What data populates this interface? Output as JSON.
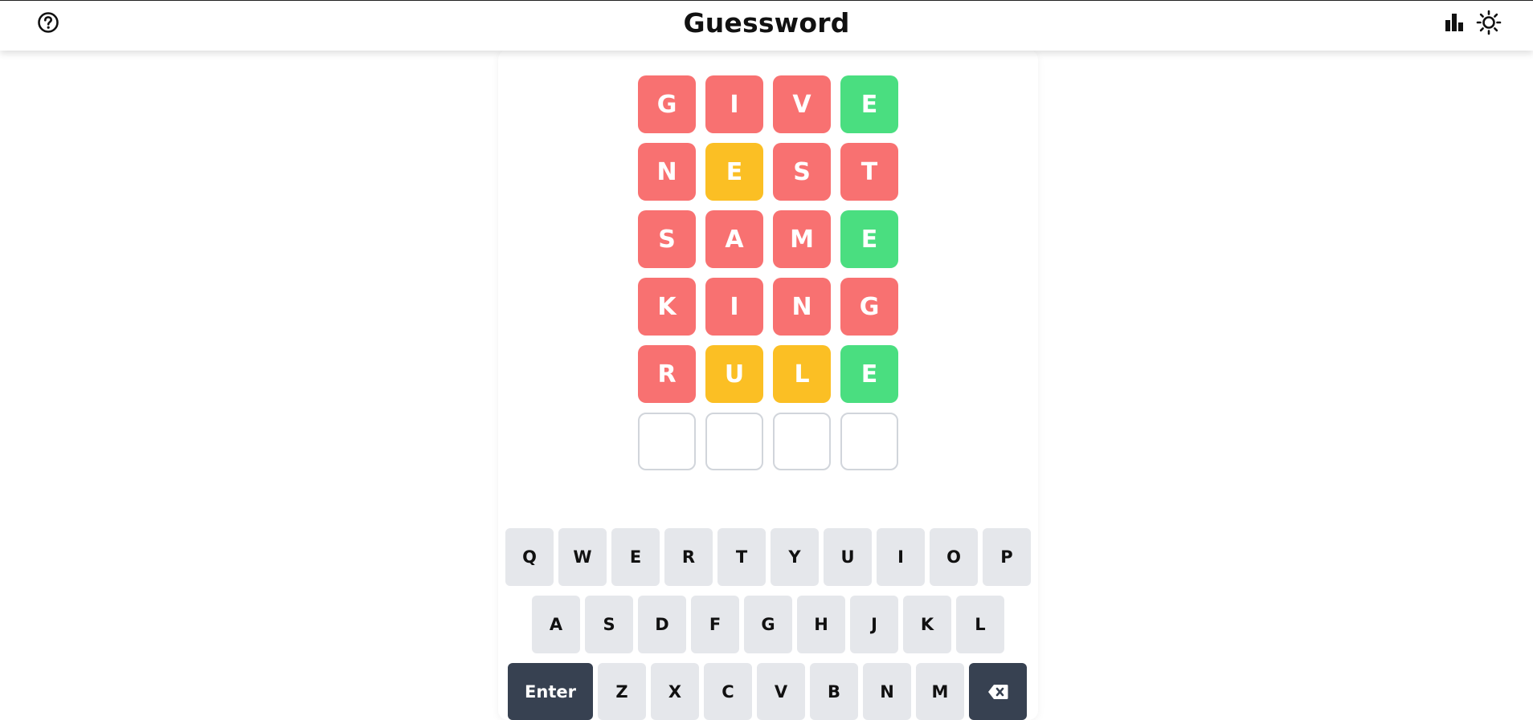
{
  "header": {
    "title": "Guessword",
    "help_icon": "question-circle-icon",
    "stats_icon": "bar-chart-icon",
    "theme_icon": "sun-icon"
  },
  "colors": {
    "absent": "#f87171",
    "present": "#fbbf24",
    "correct": "#4ade80",
    "key": "#e5e7eb",
    "key_dark": "#374151"
  },
  "board": {
    "rows": [
      [
        {
          "letter": "G",
          "state": "absent"
        },
        {
          "letter": "I",
          "state": "absent"
        },
        {
          "letter": "V",
          "state": "absent"
        },
        {
          "letter": "E",
          "state": "correct"
        }
      ],
      [
        {
          "letter": "N",
          "state": "absent"
        },
        {
          "letter": "E",
          "state": "present"
        },
        {
          "letter": "S",
          "state": "absent"
        },
        {
          "letter": "T",
          "state": "absent"
        }
      ],
      [
        {
          "letter": "S",
          "state": "absent"
        },
        {
          "letter": "A",
          "state": "absent"
        },
        {
          "letter": "M",
          "state": "absent"
        },
        {
          "letter": "E",
          "state": "correct"
        }
      ],
      [
        {
          "letter": "K",
          "state": "absent"
        },
        {
          "letter": "I",
          "state": "absent"
        },
        {
          "letter": "N",
          "state": "absent"
        },
        {
          "letter": "G",
          "state": "absent"
        }
      ],
      [
        {
          "letter": "R",
          "state": "absent"
        },
        {
          "letter": "U",
          "state": "present"
        },
        {
          "letter": "L",
          "state": "present"
        },
        {
          "letter": "E",
          "state": "correct"
        }
      ],
      [
        {
          "letter": "",
          "state": "empty"
        },
        {
          "letter": "",
          "state": "empty"
        },
        {
          "letter": "",
          "state": "empty"
        },
        {
          "letter": "",
          "state": "empty"
        }
      ]
    ]
  },
  "keyboard": {
    "rows": [
      [
        "Q",
        "W",
        "E",
        "R",
        "T",
        "Y",
        "U",
        "I",
        "O",
        "P"
      ],
      [
        "A",
        "S",
        "D",
        "F",
        "G",
        "H",
        "J",
        "K",
        "L"
      ],
      [
        "Enter",
        "Z",
        "X",
        "C",
        "V",
        "B",
        "N",
        "M",
        "Backspace"
      ]
    ],
    "enter_label": "Enter",
    "backspace_icon": "backspace-icon"
  }
}
